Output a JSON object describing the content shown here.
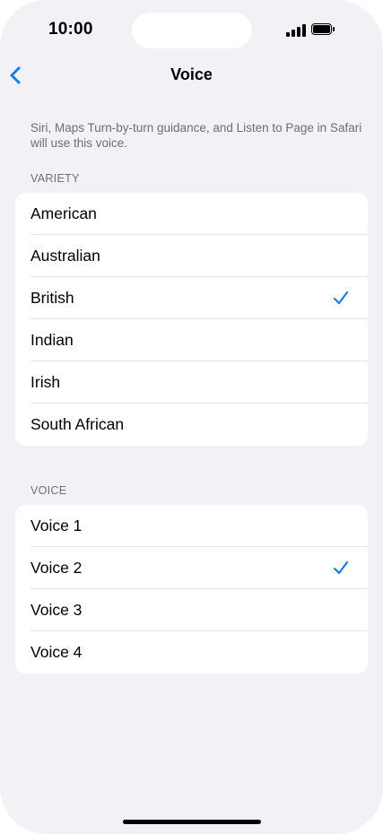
{
  "status_bar": {
    "time": "10:00"
  },
  "nav": {
    "title": "Voice",
    "back_icon": "chevron-left-icon"
  },
  "description": "Siri, Maps Turn-by-turn guidance, and Listen to Page in Safari will use this voice.",
  "variety": {
    "header": "VARIETY",
    "items": [
      {
        "label": "American",
        "selected": false
      },
      {
        "label": "Australian",
        "selected": false
      },
      {
        "label": "British",
        "selected": true
      },
      {
        "label": "Indian",
        "selected": false
      },
      {
        "label": "Irish",
        "selected": false
      },
      {
        "label": "South African",
        "selected": false
      }
    ]
  },
  "voice": {
    "header": "VOICE",
    "items": [
      {
        "label": "Voice 1",
        "selected": false
      },
      {
        "label": "Voice 2",
        "selected": true
      },
      {
        "label": "Voice 3",
        "selected": false
      },
      {
        "label": "Voice 4",
        "selected": false
      }
    ]
  },
  "colors": {
    "accent": "#1a7ee0",
    "background": "#f2f1f6",
    "secondary_text": "#6d6d72"
  }
}
